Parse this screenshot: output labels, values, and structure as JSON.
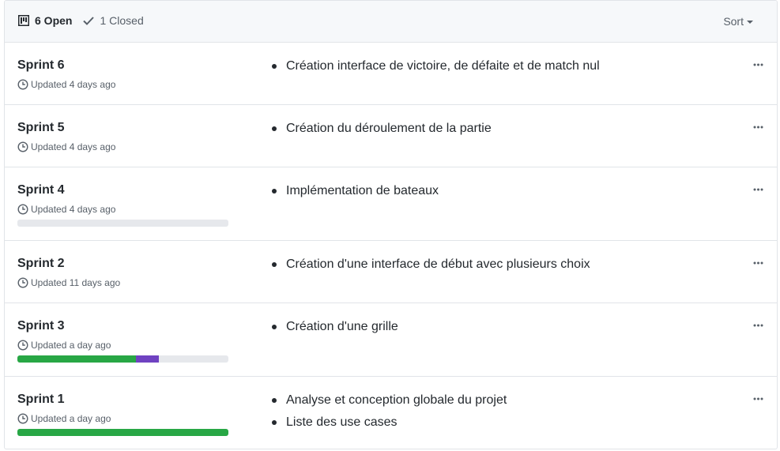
{
  "header": {
    "open_label": "6 Open",
    "closed_label": "1 Closed",
    "sort_label": "Sort",
    "open_icon": "project-icon",
    "closed_icon": "check-icon"
  },
  "milestones": [
    {
      "name": "Sprint 6",
      "updated": "Updated 4 days ago",
      "items": [
        "Création interface de victoire, de défaite et de match nul"
      ],
      "progress": null
    },
    {
      "name": "Sprint 5",
      "updated": "Updated 4 days ago",
      "items": [
        "Création du déroulement de la partie"
      ],
      "progress": null
    },
    {
      "name": "Sprint 4",
      "updated": "Updated 4 days ago",
      "items": [
        "Implémentation de bateaux"
      ],
      "progress": {
        "done": 0,
        "in_progress": 0
      }
    },
    {
      "name": "Sprint 2",
      "updated": "Updated 11 days ago",
      "items": [
        "Création d'une interface de début avec plusieurs choix"
      ],
      "progress": null
    },
    {
      "name": "Sprint 3",
      "updated": "Updated a day ago",
      "items": [
        "Création d'une grille"
      ],
      "progress": {
        "done": 0.56,
        "in_progress": 0.11
      }
    },
    {
      "name": "Sprint 1",
      "updated": "Updated a day ago",
      "items": [
        "Analyse et conception globale du projet",
        "Liste des use cases"
      ],
      "progress": {
        "done": 1.0,
        "in_progress": 0
      }
    }
  ],
  "colors": {
    "done": "#28a745",
    "in_progress": "#6f42c1",
    "track": "#e6e8ec"
  }
}
